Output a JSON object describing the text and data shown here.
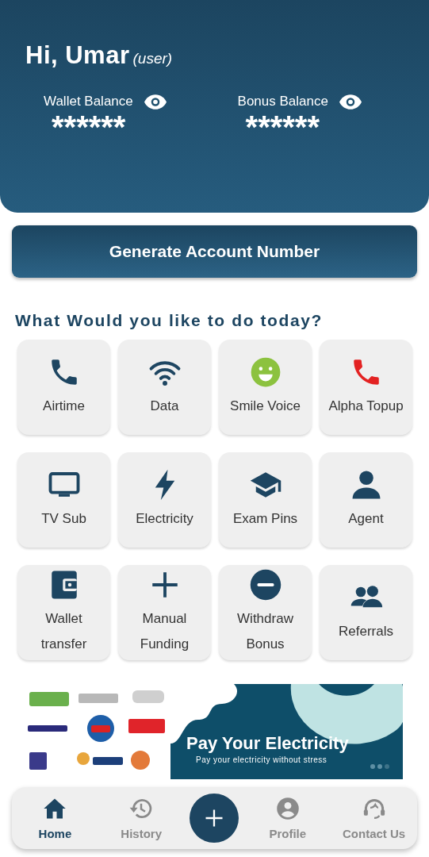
{
  "header": {
    "greeting": "Hi, Umar",
    "role": "(user)",
    "balances": [
      {
        "label": "Wallet Balance",
        "value": "******"
      },
      {
        "label": "Bonus Balance",
        "value": "******"
      }
    ]
  },
  "primary_button": "Generate Account Number",
  "section_title": "What Would you like to do today?",
  "services": [
    {
      "kind": "phone",
      "label": "Airtime"
    },
    {
      "kind": "wifi",
      "label": "Data"
    },
    {
      "kind": "smile",
      "label": "Smile Voice"
    },
    {
      "kind": "redphone",
      "label": "Alpha Topup"
    },
    {
      "kind": "tv",
      "label": "TV Sub"
    },
    {
      "kind": "bolt",
      "label": "Electricity"
    },
    {
      "kind": "cap",
      "label": "Exam Pins"
    },
    {
      "kind": "person",
      "label": "Agent"
    },
    {
      "kind": "wallet",
      "label": "Wallet\ntransfer"
    },
    {
      "kind": "plus",
      "label": "Manual\nFunding"
    },
    {
      "kind": "minus",
      "label": "Withdraw\nBonus"
    },
    {
      "kind": "group",
      "label": "Referrals"
    }
  ],
  "banner": {
    "title": "Pay Your Electricity",
    "subtitle": "Pay your electricity without stress"
  },
  "bottom_nav": [
    {
      "kind": "home",
      "label": "Home",
      "selected": true
    },
    {
      "kind": "history",
      "label": "History",
      "selected": false
    },
    {
      "kind": "fab"
    },
    {
      "kind": "profile",
      "label": "Profile",
      "selected": false
    },
    {
      "kind": "headset",
      "label": "Contact Us",
      "selected": false
    }
  ]
}
